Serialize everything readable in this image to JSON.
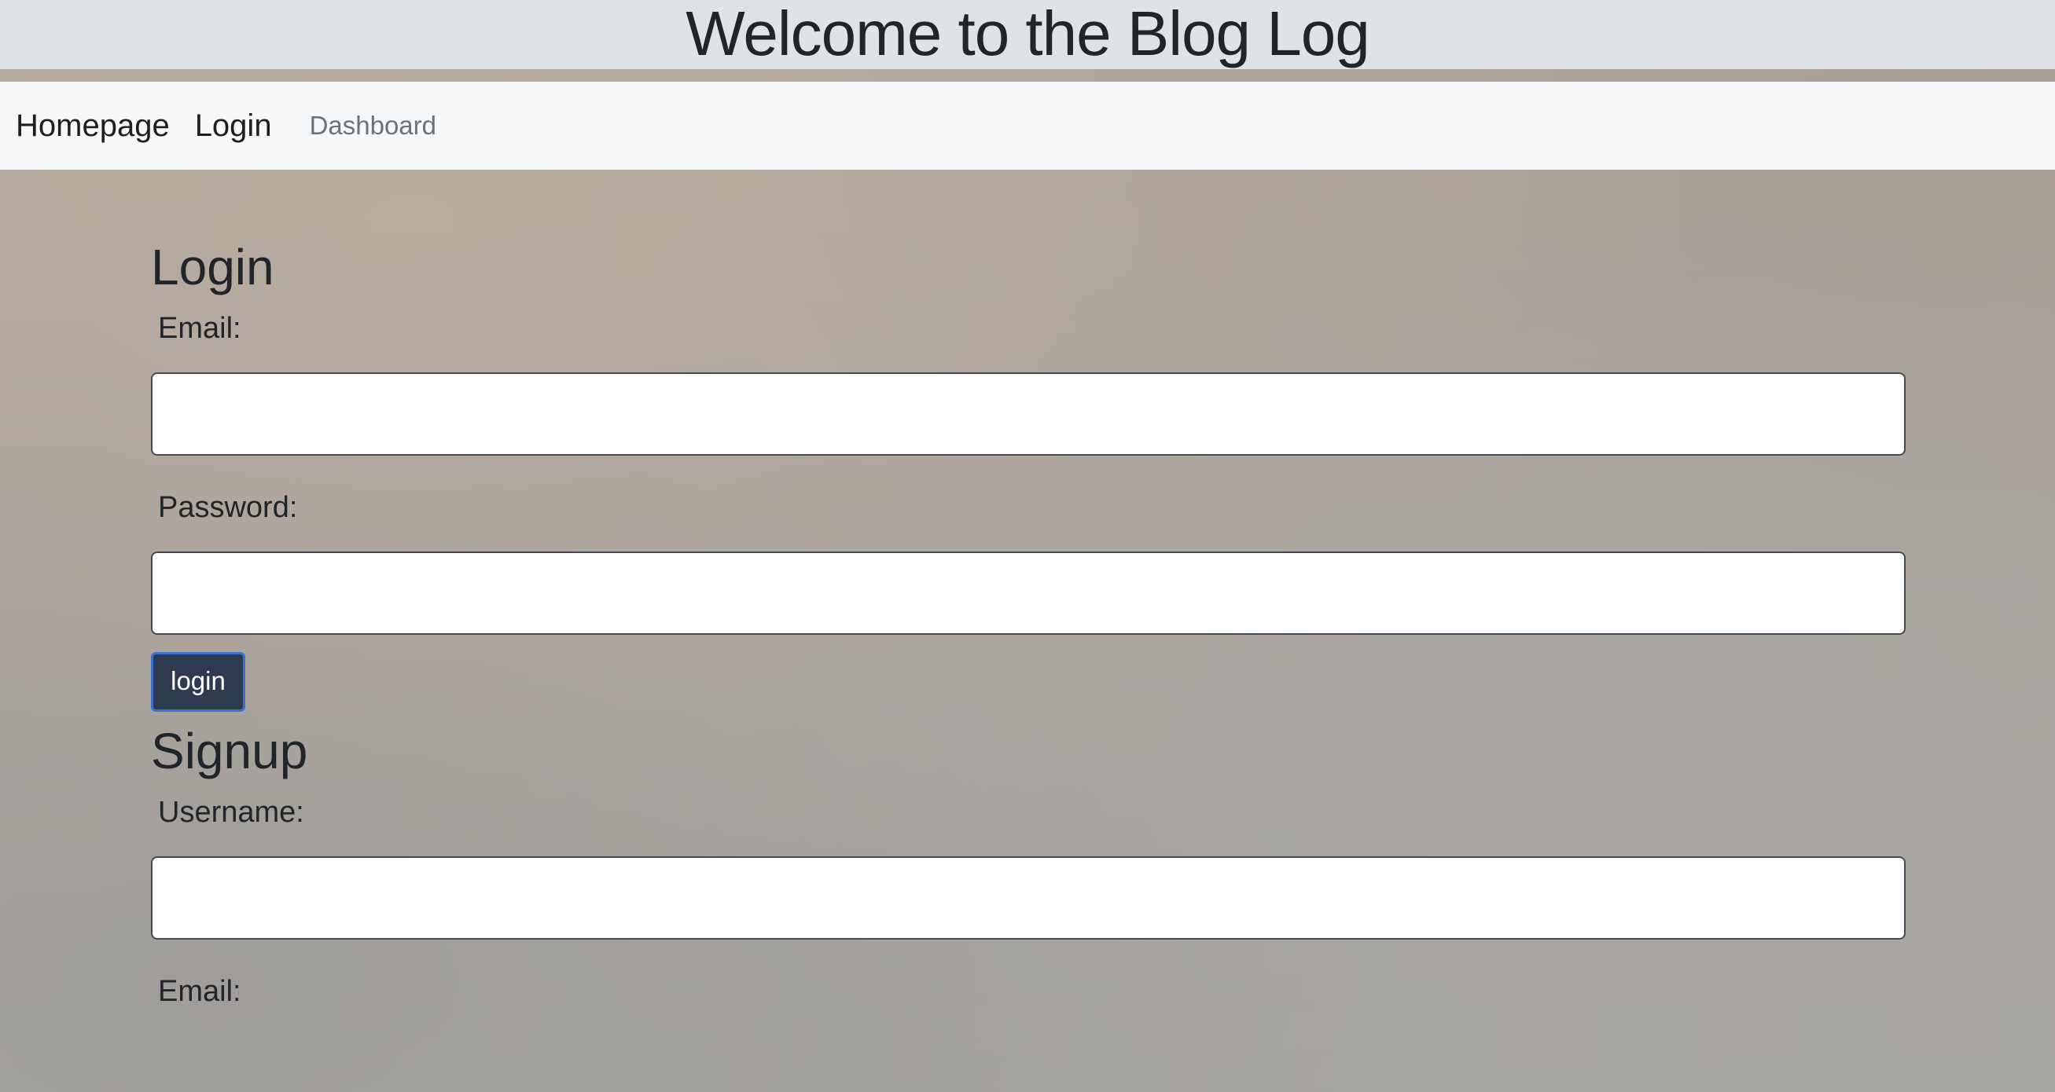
{
  "header": {
    "title": "Welcome to the Blog Log"
  },
  "nav": {
    "items": [
      {
        "label": "Homepage"
      },
      {
        "label": "Login"
      },
      {
        "label": "Dashboard"
      }
    ]
  },
  "login": {
    "heading": "Login",
    "email_label": "Email:",
    "email_value": "",
    "password_label": "Password:",
    "password_value": "",
    "submit_label": "login"
  },
  "signup": {
    "heading": "Signup",
    "username_label": "Username:",
    "username_value": "",
    "email_label": "Email:"
  },
  "colors": {
    "header_bg": "#dfe3e7",
    "navbar_bg": "#f7f8fa",
    "button_bg": "#2e3b4e",
    "button_border": "#3c6fd0"
  }
}
